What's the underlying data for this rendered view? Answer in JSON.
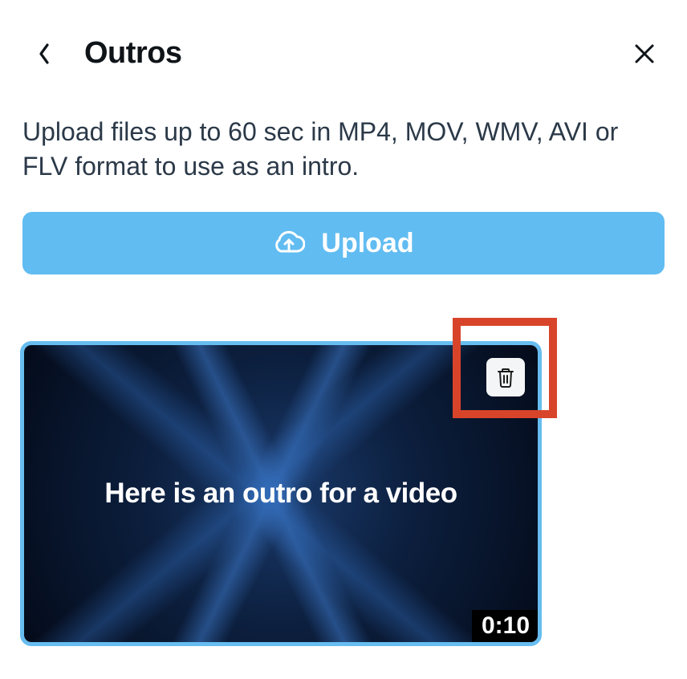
{
  "header": {
    "title": "Outros"
  },
  "description": "Upload files up to 60 sec in MP4, MOV, WMV, AVI or FLV format to use as an intro.",
  "upload": {
    "label": "Upload"
  },
  "thumbnail": {
    "caption": "Here is an outro for a video",
    "duration": "0:10"
  }
}
